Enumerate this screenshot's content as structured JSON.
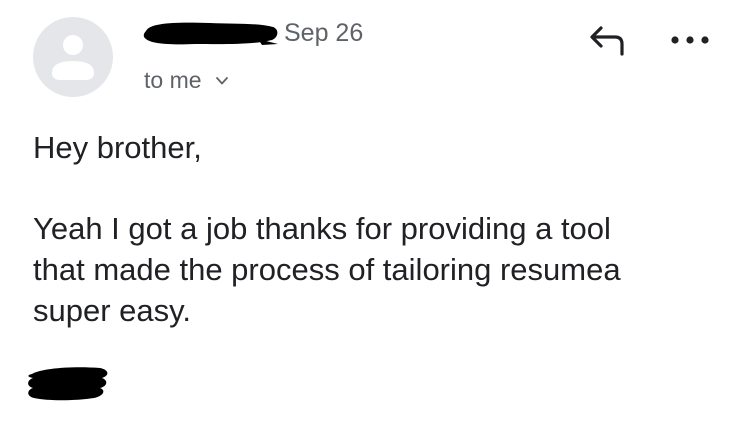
{
  "email": {
    "date": "Sep 26",
    "recipient_label": "to me",
    "greeting": "Hey brother,",
    "message": "Yeah I got a job thanks for providing a tool\nthat made the process of tailoring resumea\nsuper easy."
  },
  "icons": {
    "avatar": "person-icon",
    "recipient_toggle": "chevron-down-icon",
    "reply": "reply-arrow-icon",
    "more": "more-horizontal-icon"
  },
  "colors": {
    "text_primary": "#202124",
    "text_secondary": "#5f6368",
    "avatar_bg": "#e4e6e9",
    "avatar_fg": "#ffffff",
    "redaction": "#000000"
  }
}
